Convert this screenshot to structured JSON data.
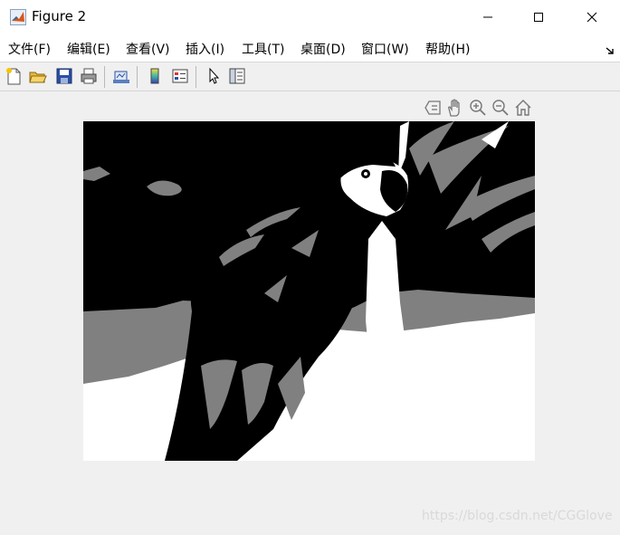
{
  "window": {
    "title": "Figure 2",
    "controls": [
      "minimize",
      "maximize",
      "close"
    ]
  },
  "menubar": {
    "items": [
      {
        "label": "文件(F)"
      },
      {
        "label": "编辑(E)"
      },
      {
        "label": "查看(V)"
      },
      {
        "label": "插入(I)"
      },
      {
        "label": "工具(T)"
      },
      {
        "label": "桌面(D)"
      },
      {
        "label": "窗口(W)"
      },
      {
        "label": "帮助(H)"
      }
    ]
  },
  "toolbar": {
    "buttons": [
      "new-figure-icon",
      "open-file-icon",
      "save-icon",
      "print-icon",
      "link-plot-icon",
      "colorbar-icon",
      "legend-icon",
      "edit-plot-arrow-icon",
      "property-inspector-icon"
    ]
  },
  "axes_toolbar": {
    "buttons": [
      "data-tips-icon",
      "pan-icon",
      "zoom-in-icon",
      "zoom-out-icon",
      "restore-view-icon"
    ]
  },
  "figure": {
    "content": "3-level quantized grayscale image of a parrot (black, gray, white)",
    "levels": [
      "#000000",
      "#808080",
      "#ffffff"
    ]
  },
  "watermark": {
    "text": "https://blog.csdn.net/CGGlove"
  }
}
